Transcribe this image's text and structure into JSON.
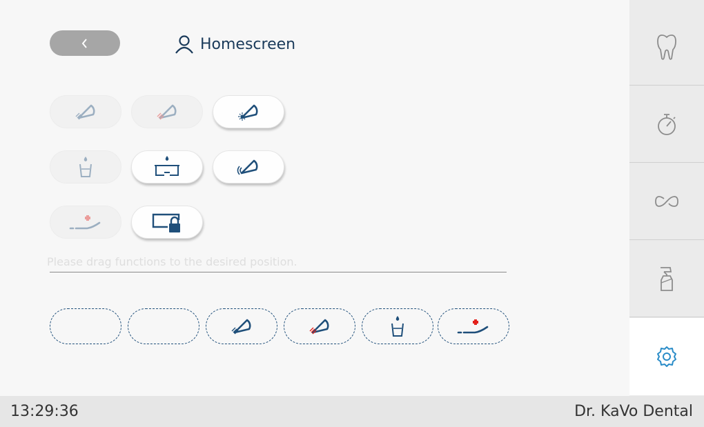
{
  "header": {
    "back_icon": "chevron-left-icon",
    "title_icon": "user-icon",
    "title": "Homescreen"
  },
  "functions": [
    {
      "name": "scaler-light-blue",
      "icon": "lamp-blue-icon",
      "enabled": false
    },
    {
      "name": "scaler-light-red",
      "icon": "lamp-red-icon",
      "enabled": false
    },
    {
      "name": "treatment-light-sun",
      "icon": "lamp-sun-icon",
      "enabled": true
    },
    {
      "name": "cup-fill",
      "icon": "cup-fill-icon",
      "enabled": false
    },
    {
      "name": "bowl-rinse",
      "icon": "bowl-rinse-icon",
      "enabled": true
    },
    {
      "name": "lamp-sensor",
      "icon": "lamp-sensor-icon",
      "enabled": true
    },
    {
      "name": "emergency-position",
      "icon": "chair-emergency-icon",
      "enabled": false
    },
    {
      "name": "screen-lock",
      "icon": "screen-lock-icon",
      "enabled": true
    }
  ],
  "hint": "Please drag functions to the desired position.",
  "slots": [
    {
      "name": "empty",
      "icon": ""
    },
    {
      "name": "empty",
      "icon": ""
    },
    {
      "name": "scaler-light-blue",
      "icon": "lamp-blue-icon"
    },
    {
      "name": "scaler-light-red",
      "icon": "lamp-red-icon"
    },
    {
      "name": "cup-fill",
      "icon": "cup-fill-icon"
    },
    {
      "name": "emergency-position",
      "icon": "chair-emergency-icon"
    }
  ],
  "sidebar": [
    {
      "name": "tooth",
      "icon": "tooth-icon",
      "active": false
    },
    {
      "name": "timer",
      "icon": "stopwatch-icon",
      "active": false
    },
    {
      "name": "loop",
      "icon": "infinity-icon",
      "active": false
    },
    {
      "name": "hygiene",
      "icon": "spray-bottle-icon",
      "active": false
    },
    {
      "name": "settings",
      "icon": "gear-icon",
      "active": true
    }
  ],
  "status": {
    "time": "13:29:36",
    "user": "Dr. KaVo Dental"
  },
  "colors": {
    "icon_blue": "#1f4f7a",
    "accent_red": "#e3211c",
    "sidebar_active": "#2a8cc8",
    "sidebar_icon": "#8c8c8c"
  }
}
